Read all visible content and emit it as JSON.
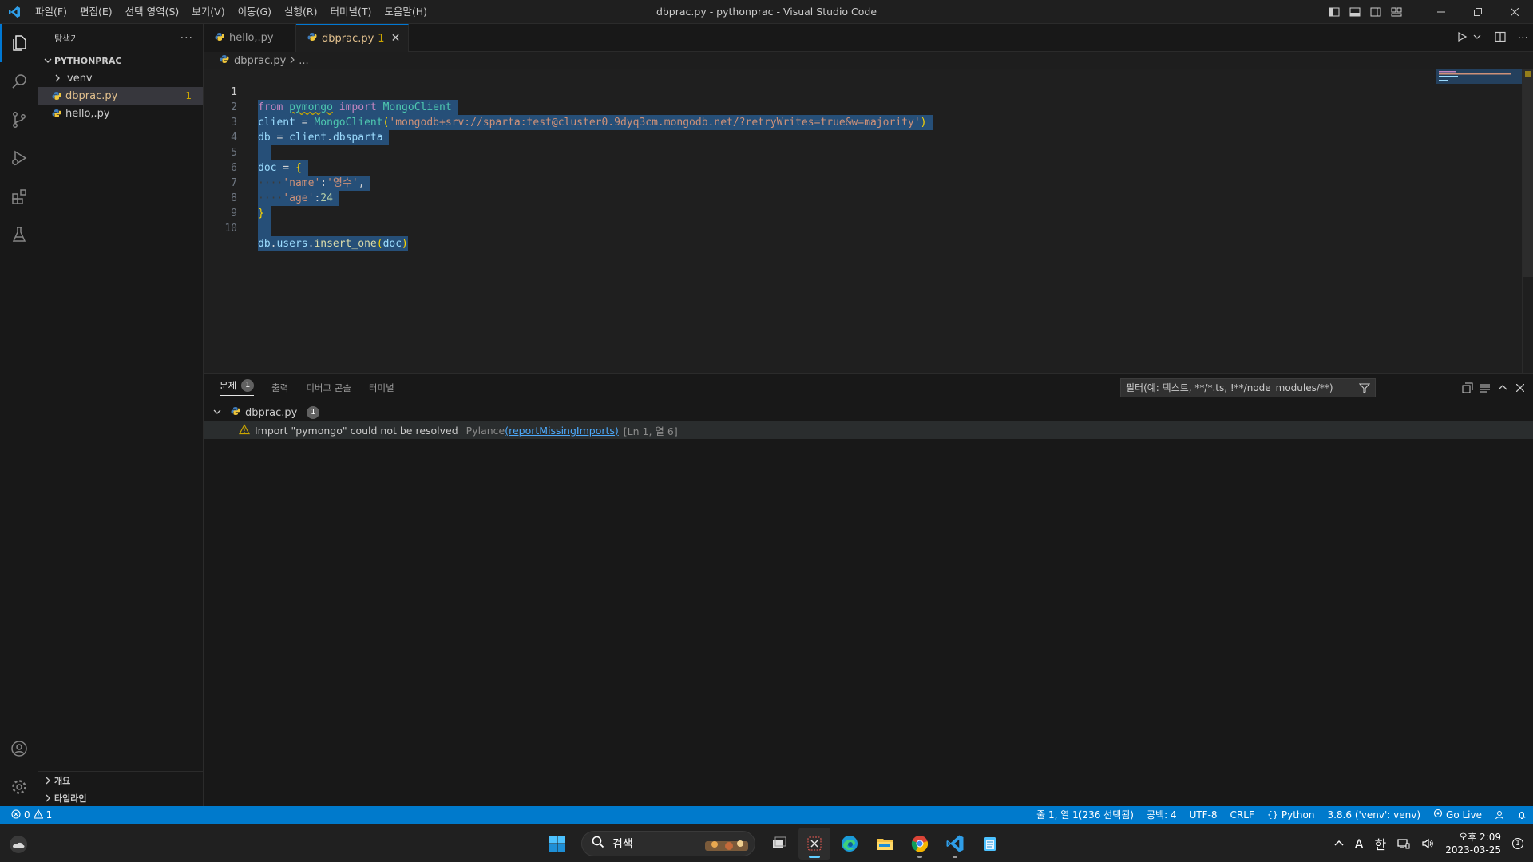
{
  "titlebar": {
    "menu": [
      "파일(F)",
      "편집(E)",
      "선택 영역(S)",
      "보기(V)",
      "이동(G)",
      "실행(R)",
      "터미널(T)",
      "도움말(H)"
    ],
    "title": "dbprac.py - pythonprac - Visual Studio Code"
  },
  "sidebar": {
    "header": "탐색기",
    "project": "PYTHONPRAC",
    "items": [
      {
        "label": "venv",
        "type": "folder"
      },
      {
        "label": "dbprac.py",
        "type": "file",
        "badge": "1"
      },
      {
        "label": "hello,.py",
        "type": "file"
      }
    ],
    "bottom_sections": [
      "개요",
      "타임라인"
    ]
  },
  "tabs": [
    {
      "label": "hello,.py"
    },
    {
      "label": "dbprac.py",
      "badge": "1"
    }
  ],
  "breadcrumb": {
    "file": "dbprac.py",
    "rest": "..."
  },
  "editor": {
    "line_numbers": [
      "1",
      "2",
      "3",
      "4",
      "5",
      "6",
      "7",
      "8",
      "9",
      "10"
    ],
    "code": {
      "l1_from": "from",
      "l1_mod": "pymongo",
      "l1_import": "import",
      "l1_cls": "MongoClient",
      "l2_var": "client",
      "l2_eq": " = ",
      "l2_cls": "MongoClient",
      "l2_open": "(",
      "l2_str": "'mongodb+srv://sparta:test@cluster0.9dyq3cm.mongodb.net/?retryWrites=true&w=majority'",
      "l2_close": ")",
      "l3_var": "db",
      "l3_eq": " = ",
      "l3_obj": "client",
      "l3_dot": ".",
      "l3_attr": "dbsparta",
      "l5_var": "doc",
      "l5_eq": " = ",
      "l5_open": "{",
      "l6_ws": "····",
      "l6_key": "'name'",
      "l6_colon": ":",
      "l6_val": "'영수'",
      "l6_comma": ",",
      "l7_ws": "····",
      "l7_key": "'age'",
      "l7_colon": ":",
      "l7_val": "24",
      "l8_close": "}",
      "l10_db": "db",
      "l10_dot1": ".",
      "l10_users": "users",
      "l10_dot2": ".",
      "l10_fn": "insert_one",
      "l10_open": "(",
      "l10_arg": "doc",
      "l10_close": ")"
    }
  },
  "panel": {
    "tabs": [
      "문제",
      "출력",
      "디버그 콘솔",
      "터미널"
    ],
    "problems_count": "1",
    "filter_placeholder": "필터(예: 텍스트, **/*.ts, !**/node_modules/**)",
    "file": "dbprac.py",
    "file_count": "1",
    "problem": {
      "message": "Import \"pymongo\" could not be resolved",
      "source": "Pylance",
      "code": "(reportMissingImports)",
      "location": "[Ln 1, 열 6]"
    }
  },
  "statusbar": {
    "errors": "0",
    "warnings": "1",
    "position": "줄 1, 열 1(236 선택됨)",
    "spaces": "공백: 4",
    "encoding": "UTF-8",
    "eol": "CRLF",
    "language": "Python",
    "interpreter": "3.8.6 ('venv': venv)",
    "golive": "Go Live"
  },
  "taskbar": {
    "search": "검색",
    "tray_lang": "A",
    "tray_ime": "한",
    "time": "오후 2:09",
    "date": "2023-03-25",
    "notifications": "1"
  },
  "colors": {
    "accent": "#007acc",
    "warning": "#cca700",
    "selection": "#264f78"
  }
}
